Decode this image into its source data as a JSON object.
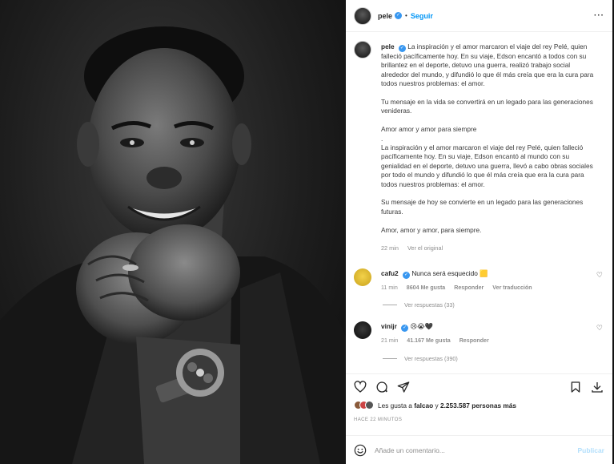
{
  "post": {
    "username": "pele",
    "follow_label": "Seguir",
    "dot": "•",
    "more": "···"
  },
  "caption": {
    "username": "pele",
    "paragraphs": [
      "La inspiración y el amor marcaron el viaje del rey Pelé, quien falleció pacíficamente hoy. En su viaje, Edson encantó a todos con su brillantez en el deporte, detuvo una guerra, realizó trabajo social alrededor del mundo, y difundió lo que él más creía que era la cura para todos nuestros problemas: el amor.",
      "Tu mensaje en la vida se convertirá en un legado para las generaciones venideras.",
      "Amor amor y amor para siempre",
      ".",
      "La inspiración y el amor marcaron el viaje del rey Pelé, quien falleció pacíficamente hoy. En su viaje, Edson encantó al mundo con su genialidad en el deporte, detuvo una guerra, llevó a cabo obras sociales por todo el mundo y difundió lo que él más creía que era la cura para todos nuestros problemas: el amor.",
      "Su mensaje de hoy se convierte en un legado para las generaciones futuras.",
      "Amor, amor y amor, para siempre."
    ],
    "time": "22 min",
    "see_original": "Ver el original"
  },
  "comments": [
    {
      "username": "cafu2",
      "text": "Nunca será esquecido 🟨",
      "time": "11 min",
      "likes": "8604 Me gusta",
      "reply": "Responder",
      "translate": "Ver traducción",
      "view_replies": "Ver respuestas (33)"
    },
    {
      "username": "vinijr",
      "text": "😢😭🖤",
      "time": "21 min",
      "likes": "41.167 Me gusta",
      "reply": "Responder",
      "view_replies": "Ver respuestas (390)"
    }
  ],
  "likes": {
    "prefix": "Les gusta a",
    "first": "falcao",
    "connector": "y",
    "count": "2.253.587",
    "suffix": "personas más"
  },
  "time_ago": "HACE 22 MINUTOS",
  "add_comment": {
    "placeholder": "Añade un comentario...",
    "post_label": "Publicar"
  },
  "icons": {
    "like": "heart-icon",
    "comment": "comment-icon",
    "share": "share-icon",
    "save": "bookmark-icon",
    "download": "download-icon",
    "emoji": "emoji-icon"
  },
  "colors": {
    "accent": "#0095f6",
    "verified": "#3897f0",
    "muted": "#8e8e8e"
  }
}
